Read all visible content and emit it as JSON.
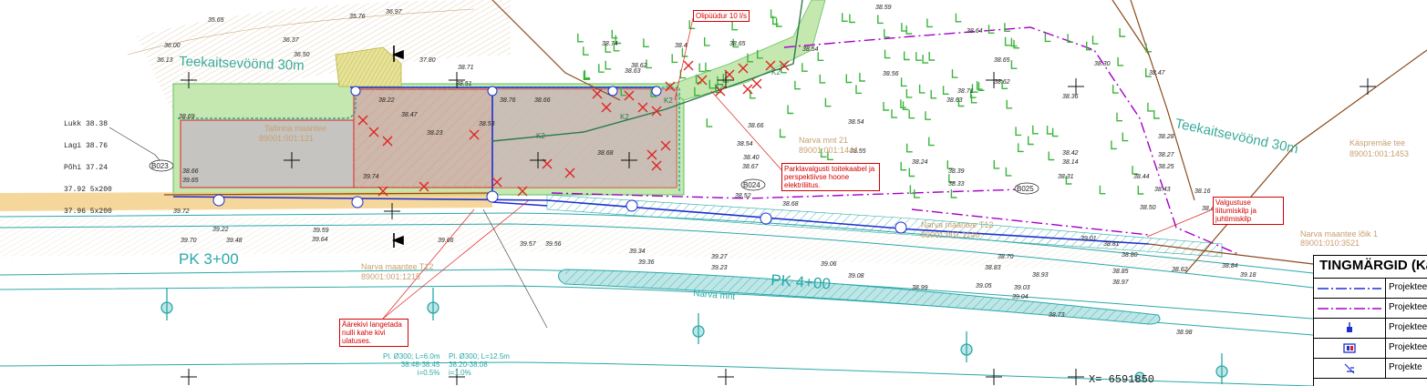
{
  "map": {
    "zone_labels": [
      "Teekaitsevöönd 30m",
      "Teekaitsevöönd 30m"
    ],
    "pk_labels": [
      "PK 3+00",
      "PK 4+00"
    ],
    "road_label": "Narva mnt",
    "coordinate": "X= 6591850",
    "parcels": [
      {
        "name": "Narva mnt 21",
        "id": "89001:001:1444"
      },
      {
        "name": "Narva maantee T12",
        "id": "89001:001:1215"
      },
      {
        "name": "Narva maantee T12",
        "id": "89001:001:1146"
      },
      {
        "name": "Käspremäe tee",
        "id": "89001:001:1453"
      },
      {
        "name": "Narva maantee lõik 1",
        "id": "89001:010:3521"
      },
      {
        "name": "Tallinna maantee",
        "id": "89001:001:121"
      }
    ],
    "callouts": [
      "Olipüüdur 10 l/s",
      "Parklavalgusti toitekaabel ja perspektiivse hoone elektriliitus.",
      "Valgustuse liitumiskilp ja juhtimiskilp",
      "Äärekivi langetada nulli kahe kivi ulatuses."
    ],
    "pipe_notes": [
      "Pl. Ø300; L=6.0m\n38.48-38.45\ni=0.5%",
      "Pl. Ø300; L=12.5m\n38.20-38.08\ni=1.0%"
    ],
    "cable_labels": [
      "K2",
      "K2",
      "K2",
      "K2",
      "K2"
    ],
    "station_codes": [
      "B023",
      "B024",
      "B025"
    ],
    "elev_header": [
      "Lukk 38.38",
      "Lagi 38.76",
      "Põhi 37.24",
      "37.92 5x200",
      "37.96 5x200"
    ],
    "elevations": [
      "35.65",
      "35.76",
      "36.97",
      "36.00",
      "36.13",
      "36.37",
      "36.50",
      "37.80",
      "38.71",
      "38.51",
      "38.22",
      "38.74",
      "38.63",
      "38.62",
      "38.4",
      "38.65",
      "38.54",
      "38.59",
      "38.56",
      "38.64",
      "38.65",
      "38.71",
      "38.30",
      "38.47",
      "38.36",
      "38.63",
      "38.62",
      "38.54",
      "38.76",
      "38.66",
      "38.47",
      "38.53",
      "38.23",
      "38.68",
      "38.54",
      "38.40",
      "38.67",
      "38.66",
      "38.55",
      "38.24",
      "38.55",
      "38.42",
      "38.14",
      "38.27",
      "38.31",
      "38.33",
      "38.39",
      "38.25",
      "38.28",
      "38.44",
      "38.43",
      "38.16",
      "38.50",
      "38.47",
      "38.52",
      "38.68",
      "38.69",
      "38.66",
      "39.65",
      "39.74",
      "39.72",
      "39.22",
      "39.59",
      "39.70",
      "39.64",
      "39.48",
      "39.66",
      "39.57",
      "39.56",
      "39.34",
      "39.36",
      "39.27",
      "39.23",
      "39.06",
      "39.08",
      "38.99",
      "39.05",
      "39.04",
      "39.03",
      "38.73",
      "38.80",
      "38.84",
      "38.85",
      "38.97",
      "38.70",
      "38.62",
      "38.81",
      "39.01",
      "38.98",
      "39.18",
      "38.83",
      "38.93"
    ]
  },
  "legend": {
    "title": "TINGMÄRGID (Ka",
    "rows": [
      {
        "label": "Projektee",
        "symbol": "blue-dashdot-line-icon"
      },
      {
        "label": "Projektee",
        "symbol": "purple-dashdot-line-icon"
      },
      {
        "label": "Projektee",
        "symbol": "hydrant-icon"
      },
      {
        "label": "Projektee",
        "symbol": "well-box-icon"
      },
      {
        "label": "Projekte",
        "symbol": "outlet-icon"
      }
    ]
  },
  "colors": {
    "paved": "#c6c4c0",
    "hatch": "#d9a08c",
    "green": "#62c262",
    "teal": "#2aa8a8",
    "blue": "#1c2fd0",
    "purple": "#a400c8",
    "red": "#e02020",
    "brown": "#8b4a1c",
    "ochre": "#f3c97a"
  }
}
